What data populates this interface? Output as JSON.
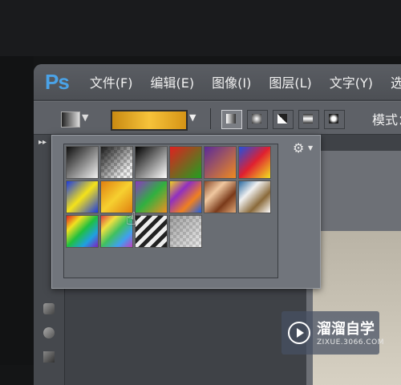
{
  "app": {
    "logo": "Ps"
  },
  "menu": [
    {
      "label": "文件(F)"
    },
    {
      "label": "编辑(E)"
    },
    {
      "label": "图像(I)"
    },
    {
      "label": "图层(L)"
    },
    {
      "label": "文字(Y)"
    },
    {
      "label": "选择"
    }
  ],
  "options_bar": {
    "mode_label": "模式：",
    "selected_gradient_colors": [
      "#c98a12",
      "#f6c33a",
      "#d59416"
    ],
    "gradient_types": [
      {
        "name": "linear-gradient-icon",
        "selected": true
      },
      {
        "name": "radial-gradient-icon",
        "selected": false
      },
      {
        "name": "angle-gradient-icon",
        "selected": false
      },
      {
        "name": "reflected-gradient-icon",
        "selected": false
      },
      {
        "name": "diamond-gradient-icon",
        "selected": false
      }
    ]
  },
  "gradient_picker": {
    "settings_icon": "gear-icon",
    "presets": [
      {
        "name": "foreground-to-background",
        "css": "linear-gradient(135deg,#0d0d0d,#f2f2f2)"
      },
      {
        "name": "foreground-to-transparent",
        "css": "linear-gradient(135deg,#1a1a1a 0%,rgba(0,0,0,0) 80%), repeating-conic-gradient(#bbb 0% 25%,#eee 0% 50%) 0 0/8px 8px"
      },
      {
        "name": "black-white",
        "css": "linear-gradient(135deg,#000,#fff)"
      },
      {
        "name": "red-green",
        "css": "linear-gradient(135deg,#e02020,#20a020)"
      },
      {
        "name": "violet-orange",
        "css": "linear-gradient(135deg,#5a2a9a,#f08a20)"
      },
      {
        "name": "blue-red-yellow",
        "css": "linear-gradient(135deg,#2050e0,#e02030,#f0e020)"
      },
      {
        "name": "blue-yellow-blue",
        "css": "linear-gradient(135deg,#1c3be0,#f4e21a,#1c3be0)"
      },
      {
        "name": "orange-yellow-orange",
        "css": "linear-gradient(135deg,#e08010,#f6d030,#e08010)"
      },
      {
        "name": "violet-green-orange",
        "css": "linear-gradient(135deg,#8a3ac0,#30b040,#f09020)"
      },
      {
        "name": "yellow-violet-orange-blue",
        "css": "linear-gradient(135deg,#f0d020,#9030c0,#f08020,#2060e0)"
      },
      {
        "name": "copper",
        "css": "linear-gradient(135deg,#8a4a2a,#f0c8a0,#7a3a1a,#e0a878)"
      },
      {
        "name": "chrome",
        "css": "linear-gradient(135deg,#2a6aa0,#f0f0f0,#8a6a3a,#fff)"
      },
      {
        "name": "spectrum",
        "css": "linear-gradient(135deg,#e02020,#f0e020,#20c040,#20a0e0,#8020c0)"
      },
      {
        "name": "transparent-rainbow",
        "css": "linear-gradient(135deg,#e04040,#f0e040,#40c060,#40a0f0,#c040c0)"
      },
      {
        "name": "transparent-stripes",
        "css": "repeating-linear-gradient(135deg,#222 0 5px,#eee 5px 10px)"
      },
      {
        "name": "neutral-density",
        "css": "linear-gradient(135deg,rgba(0,0,0,0.3),rgba(0,0,0,0)), repeating-conic-gradient(#c8c8c8 0% 25%,#e8e8e8 0% 50%) 0 0/8px 8px"
      }
    ]
  },
  "watermark": {
    "title": "溜溜自学",
    "url": "ZIXUE.3066.COM"
  }
}
